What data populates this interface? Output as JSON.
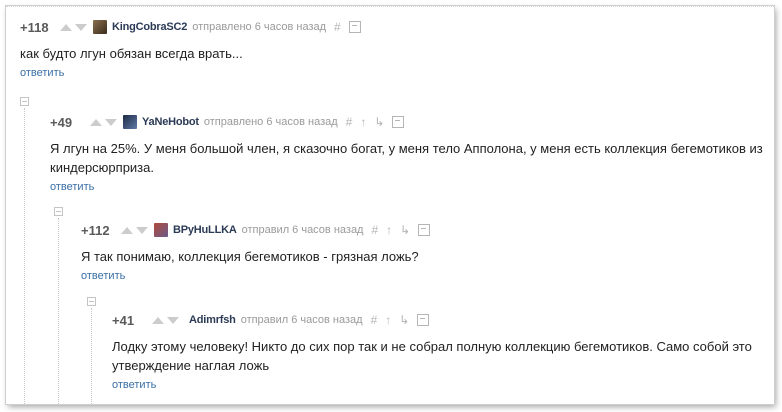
{
  "comments": [
    {
      "rating": "+118",
      "author": "KingCobraSC2",
      "meta": "отправлено 6 часов назад",
      "text": "как будто лгун обязан всегда врать...",
      "reply": "ответить"
    },
    {
      "rating": "+49",
      "author": "YaNeHobot",
      "meta": "отправлено 6 часов назад",
      "text": "Я лгун на 25%. У меня большой член, я сказочно богат, у меня тело Апполона, у меня есть коллекция бегемотиков из киндерсюрприза.",
      "reply": "ответить"
    },
    {
      "rating": "+112",
      "author": "BPyHuLLKA",
      "meta": "отправил 6 часов назад",
      "text": "Я так понимаю, коллекция бегемотиков - грязная ложь?",
      "reply": "ответить"
    },
    {
      "rating": "+41",
      "author": "Adimrfsh",
      "meta": "отправил 6 часов назад",
      "text": "Лодку этому человеку! Никто до сих пор так и не собрал полную коллекцию бегемотиков. Само собой это утверждение наглая ложь",
      "reply": "ответить"
    }
  ],
  "icons": {
    "hash": "#",
    "up_arrow": "↑",
    "branch": "↳"
  },
  "colors": {
    "author": "#2b3a55",
    "reply_link": "#3a6ea5",
    "meta": "#9a9a9a"
  }
}
